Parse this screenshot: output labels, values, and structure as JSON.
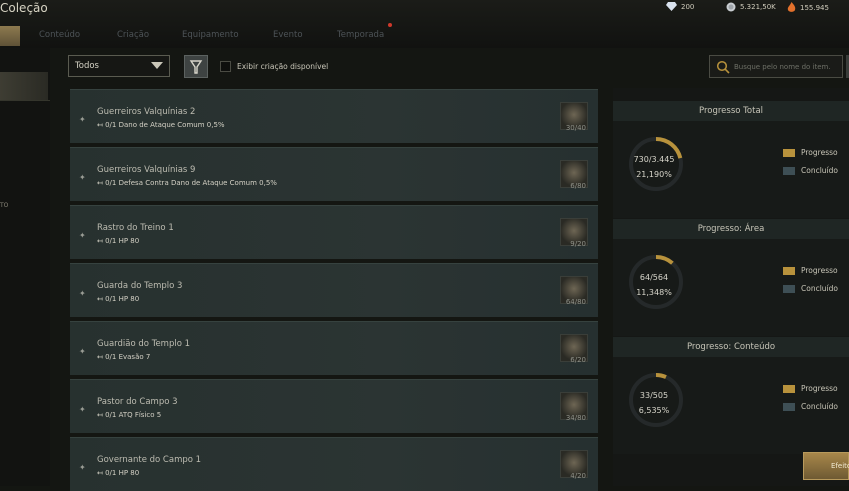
{
  "window": {
    "title": "Coleção"
  },
  "currencies": [
    {
      "icon": "diamond-icon",
      "value": "200"
    },
    {
      "icon": "silver-coin-icon",
      "value": "5.321,50K"
    },
    {
      "icon": "flame-icon",
      "value": "155.945"
    }
  ],
  "tabs": [
    {
      "label": "Conteúdo"
    },
    {
      "label": "Criação"
    },
    {
      "label": "Equipamento"
    },
    {
      "label": "Evento"
    },
    {
      "label": "Temporada"
    }
  ],
  "sidebar": {
    "partial_text": "TO"
  },
  "filters": {
    "dropdown_value": "Todos",
    "checkbox_label": "Exibir criação disponível",
    "search_placeholder": "Busque pelo nome do item."
  },
  "items": [
    {
      "name": "Guerreiros Valquínias 2",
      "stat": "↤ 0/1 Dano de Ataque Comum 0,5%",
      "count": "30/40"
    },
    {
      "name": "Guerreiros Valquínias 9",
      "stat": "↤ 0/1 Defesa Contra Dano de Ataque Comum 0,5%",
      "count": "6/80"
    },
    {
      "name": "Rastro do Treino 1",
      "stat": "↤ 0/1 HP 80",
      "count": "9/20"
    },
    {
      "name": "Guarda do Templo 3",
      "stat": "↤ 0/1 HP 80",
      "count": "64/80"
    },
    {
      "name": "Guardião do Templo 1",
      "stat": "↤ 0/1 Evasão 7",
      "count": "6/20"
    },
    {
      "name": "Pastor do Campo 3",
      "stat": "↤ 0/1 ATQ Físico 5",
      "count": "34/80"
    },
    {
      "name": "Governante do Campo 1",
      "stat": "↤ 0/1 HP 80",
      "count": "4/20"
    }
  ],
  "progress_sections": [
    {
      "title": "Progresso Total",
      "value": "730/3.445",
      "percent": "21,190%",
      "fraction": 0.2119
    },
    {
      "title": "Progresso: Área",
      "value": "64/564",
      "percent": "11,348%",
      "fraction": 0.1135
    },
    {
      "title": "Progresso: Conteúdo",
      "value": "33/505",
      "percent": "6,535%",
      "fraction": 0.0653
    }
  ],
  "legend": {
    "progress_label": "Progresso",
    "done_label": "Concluído"
  },
  "colors": {
    "progress": "#b8923c",
    "done": "#3e4f55",
    "ring_track": "#25292a"
  },
  "effect_button": {
    "label": "Efeito"
  }
}
